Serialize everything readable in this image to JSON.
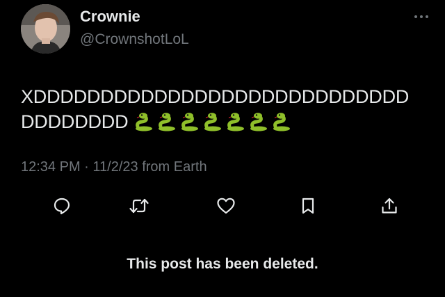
{
  "author": {
    "display_name": "Crownie",
    "handle": "@CrownshotLoL"
  },
  "tweet": {
    "text_line1": "XDDDDDDDDDDDDDDDDDDDDDDDDDDDD",
    "text_line2": "DDDDDDDD",
    "emoji": "snake",
    "emoji_count": 7
  },
  "meta": {
    "time": "12:34 PM",
    "separator": "·",
    "date": "11/2/23",
    "source": "from Earth"
  },
  "actions": [
    "reply-icon",
    "retweet-icon",
    "like-icon",
    "bookmark-icon",
    "share-icon"
  ],
  "notice": "This post has been deleted.",
  "colors": {
    "background": "#000000",
    "text": "#e7e9ea",
    "secondary": "#71767b",
    "snake": "#8fbf2a"
  }
}
